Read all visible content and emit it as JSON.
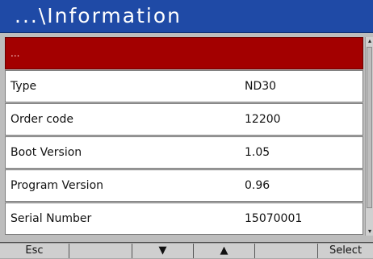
{
  "window": {
    "title": "...\\Information"
  },
  "list": {
    "selected_label": "...",
    "rows": [
      {
        "label": "Type",
        "value": "ND30"
      },
      {
        "label": "Order code",
        "value": "12200"
      },
      {
        "label": "Boot Version",
        "value": "1.05"
      },
      {
        "label": "Program Version",
        "value": "0.96"
      },
      {
        "label": "Serial Number",
        "value": "15070001"
      }
    ]
  },
  "softkeys": {
    "esc": "Esc",
    "down": "▼",
    "up": "▲",
    "select": "Select"
  },
  "colors": {
    "title_bar": "#1f4aa6",
    "selected_row": "#a30000",
    "row_bg": "#ffffff"
  }
}
